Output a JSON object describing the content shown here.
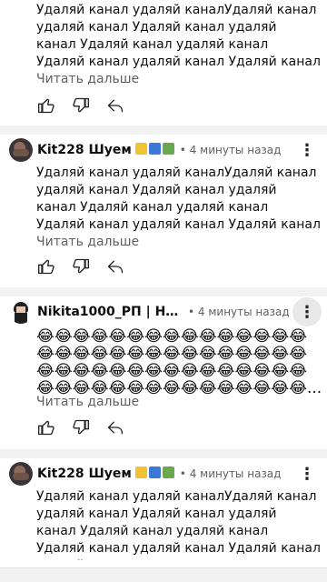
{
  "feed": {
    "read_more": "Читать дальше",
    "comments": [
      {
        "author": "",
        "time": "",
        "text": "Удаляй канал удаляй каналУдаляй канал\nудаляй канал Удаляй канал удаляй\nканал Удаляй канал удаляй канал\nУдаляй канал удаляй канал Удаляй канал удаляй..."
      },
      {
        "author": "Kit228 Шуем",
        "flag_colors": [
          "#f1c232",
          "#3c78d8",
          "#6aa84f"
        ],
        "time": "• 4 минуты назад",
        "text": "Удаляй канал удаляй каналУдаляй канал\nудаляй канал Удаляй канал удаляй\nканал Удаляй канал удаляй канал\nУдаляй канал удаляй канал Удаляй канал удаляй..."
      },
      {
        "author": "Nikita1000_РП | НО...",
        "time": "• 4 минуты назад",
        "emoji_rows": [
          "😂😂😂😂😂😂😂😂😂😂😂😂😂😂😂",
          "😂😂😂😂😂😂😂😂😂😂😂😂😂😂😂",
          "😂😂😂😂😂😂😂😂😂😂😂😂😂😂😂",
          "😂😂😂😂😂😂😂😂😂😂😂😂😂😂😂..."
        ]
      },
      {
        "author": "Kit228 Шуем",
        "flag_colors": [
          "#f1c232",
          "#3c78d8",
          "#6aa84f"
        ],
        "time": "• 4 минуты назад",
        "text": "Удаляй канал удаляй каналУдаляй канал\nудаляй канал Удаляй канал удаляй\nканал Удаляй канал удаляй канал\nУдаляй канал удаляй канал Удаляй канал удаляй..."
      }
    ]
  },
  "icons": {
    "like": "thumbs-up-icon",
    "dislike": "thumbs-down-icon",
    "reply": "reply-icon",
    "menu": "more-vert-icon"
  }
}
